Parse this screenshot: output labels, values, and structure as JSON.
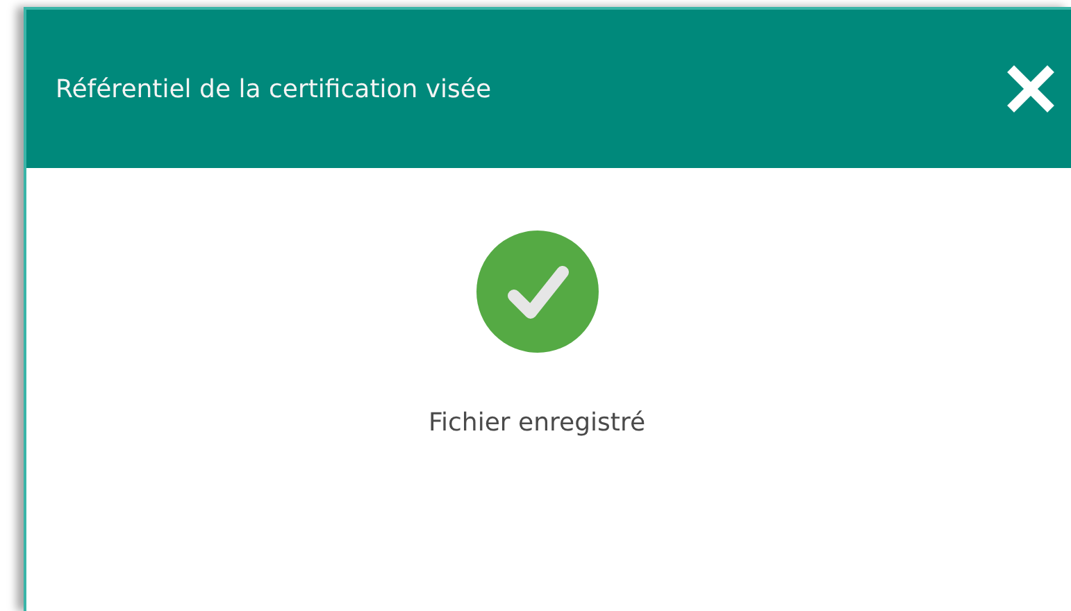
{
  "dialog": {
    "title": "Référentiel de la certification visée",
    "message": "Fichier enregistré"
  }
}
